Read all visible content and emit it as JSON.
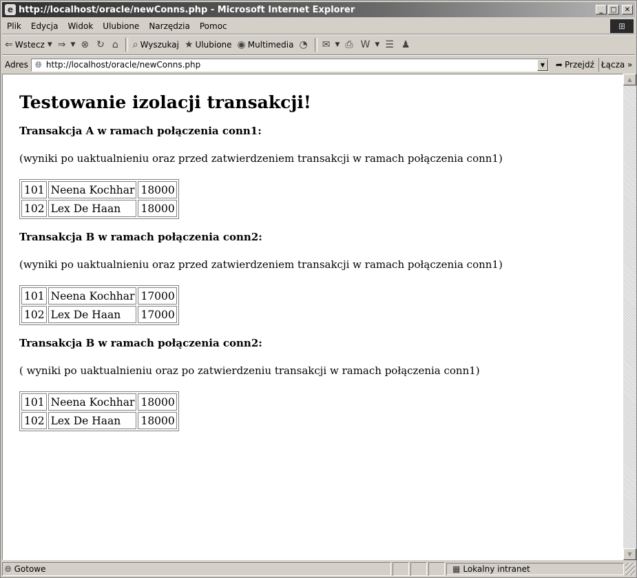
{
  "window": {
    "title": "http://localhost/oracle/newConns.php - Microsoft Internet Explorer",
    "min_label": "_",
    "max_label": "□",
    "close_label": "✕"
  },
  "menu": [
    "Plik",
    "Edycja",
    "Widok",
    "Ulubione",
    "Narzędzia",
    "Pomoc"
  ],
  "toolbar": {
    "back_label": "Wstecz",
    "search_label": "Wyszukaj",
    "favorites_label": "Ulubione",
    "media_label": "Multimedia"
  },
  "address": {
    "label": "Adres",
    "url": "http://localhost/oracle/newConns.php",
    "go_label": "Przejdź",
    "links_label": "Łącza »"
  },
  "page": {
    "heading": "Testowanie izolacji transakcji!",
    "sections": [
      {
        "title": "Transakcja A w ramach połączenia conn1:",
        "note": "(wyniki po uaktualnieniu oraz przed zatwierdzeniem transakcji w ramach połączenia conn1)",
        "rows": [
          [
            "101",
            "Neena Kochhar",
            "18000"
          ],
          [
            "102",
            "Lex De Haan",
            "18000"
          ]
        ]
      },
      {
        "title": "Transakcja B w ramach połączenia conn2:",
        "note": "(wyniki po uaktualnieniu oraz przed zatwierdzeniem transakcji w ramach połączenia conn1)",
        "rows": [
          [
            "101",
            "Neena Kochhar",
            "17000"
          ],
          [
            "102",
            "Lex De Haan",
            "17000"
          ]
        ]
      },
      {
        "title": "Transakcja B w ramach połączenia conn2:",
        "note": "( wyniki po uaktualnieniu oraz po zatwierdzeniu transakcji w ramach połączenia conn1)",
        "rows": [
          [
            "101",
            "Neena Kochhar",
            "18000"
          ],
          [
            "102",
            "Lex De Haan",
            "18000"
          ]
        ]
      }
    ]
  },
  "status": {
    "text": "Gotowe",
    "zone": "Lokalny intranet"
  },
  "icons": {
    "title": "ie-icon",
    "back": "back-arrow-icon",
    "forward": "forward-arrow-icon",
    "stop": "stop-icon",
    "refresh": "refresh-icon",
    "home": "home-icon",
    "search": "search-icon",
    "favorites": "favorites-icon",
    "media": "media-icon",
    "history": "history-icon",
    "mail": "mail-icon",
    "print": "print-icon",
    "edit": "edit-icon",
    "discuss": "discuss-icon",
    "messenger": "messenger-icon",
    "page": "page-icon",
    "go": "go-arrow-icon",
    "zone": "intranet-zone-icon"
  }
}
